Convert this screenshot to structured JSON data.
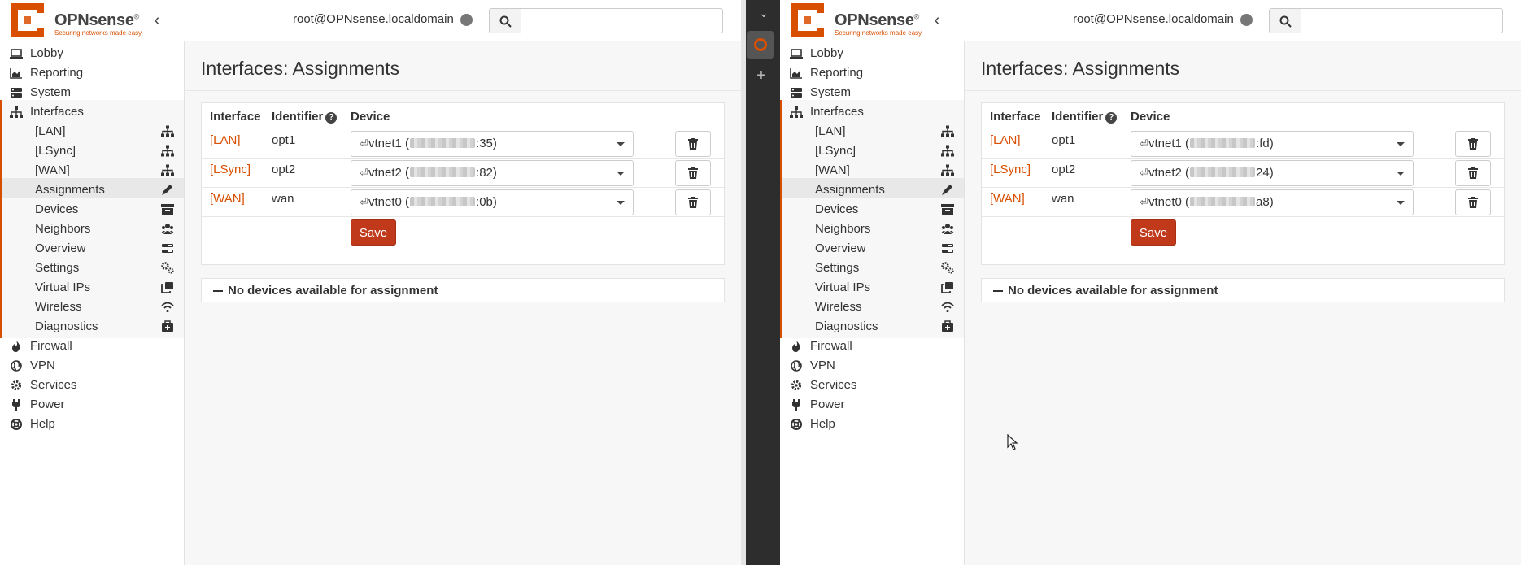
{
  "app": {
    "brand": "OPNsense",
    "trademark": "®",
    "tagline": "Securing networks made easy",
    "user": "root@OPNsense.localdomain",
    "search_placeholder": ""
  },
  "nav": {
    "top": [
      {
        "label": "Lobby",
        "icon": "laptop-icon"
      },
      {
        "label": "Reporting",
        "icon": "area-chart-icon"
      },
      {
        "label": "System",
        "icon": "server-icon"
      },
      {
        "label": "Interfaces",
        "icon": "sitemap-icon"
      }
    ],
    "interfaces_sub": [
      {
        "label": "[LAN]",
        "icon": "sitemap-icon"
      },
      {
        "label": "[LSync]",
        "icon": "sitemap-icon"
      },
      {
        "label": "[WAN]",
        "icon": "sitemap-icon"
      },
      {
        "label": "Assignments",
        "icon": "pencil-icon"
      },
      {
        "label": "Devices",
        "icon": "archive-icon"
      },
      {
        "label": "Neighbors",
        "icon": "users-icon"
      },
      {
        "label": "Overview",
        "icon": "tasks-icon"
      },
      {
        "label": "Settings",
        "icon": "cogs-icon"
      },
      {
        "label": "Virtual IPs",
        "icon": "clone-icon"
      },
      {
        "label": "Wireless",
        "icon": "wifi-icon"
      },
      {
        "label": "Diagnostics",
        "icon": "medkit-icon"
      }
    ],
    "bottom": [
      {
        "label": "Firewall",
        "icon": "fire-icon"
      },
      {
        "label": "VPN",
        "icon": "globe-icon"
      },
      {
        "label": "Services",
        "icon": "cog-icon"
      },
      {
        "label": "Power",
        "icon": "plug-icon"
      },
      {
        "label": "Help",
        "icon": "life-ring-icon"
      }
    ]
  },
  "page": {
    "title": "Interfaces: Assignments",
    "col_interface": "Interface",
    "col_identifier": "Identifier",
    "col_device": "Device",
    "save_label": "Save",
    "no_devices": "No devices available for assignment"
  },
  "left": {
    "rows": [
      {
        "interface": "[LAN]",
        "identifier": "opt1",
        "device_prefix": "vtnet1 (",
        "device_suffix": ":35)"
      },
      {
        "interface": "[LSync]",
        "identifier": "opt2",
        "device_prefix": "vtnet2 (",
        "device_suffix": ":82)"
      },
      {
        "interface": "[WAN]",
        "identifier": "wan",
        "device_prefix": "vtnet0 (",
        "device_suffix": ":0b)"
      }
    ]
  },
  "right": {
    "rows": [
      {
        "interface": "[LAN]",
        "identifier": "opt1",
        "device_prefix": "vtnet1 (",
        "device_suffix": ":fd)"
      },
      {
        "interface": "[LSync]",
        "identifier": "opt2",
        "device_prefix": "vtnet2 (",
        "device_suffix": "24)"
      },
      {
        "interface": "[WAN]",
        "identifier": "wan",
        "device_prefix": "vtnet0 (",
        "device_suffix": "a8)"
      }
    ]
  },
  "colors": {
    "accent": "#d94f00",
    "save_button": "#c0391b",
    "divider_bar": "#2d2d2d"
  }
}
